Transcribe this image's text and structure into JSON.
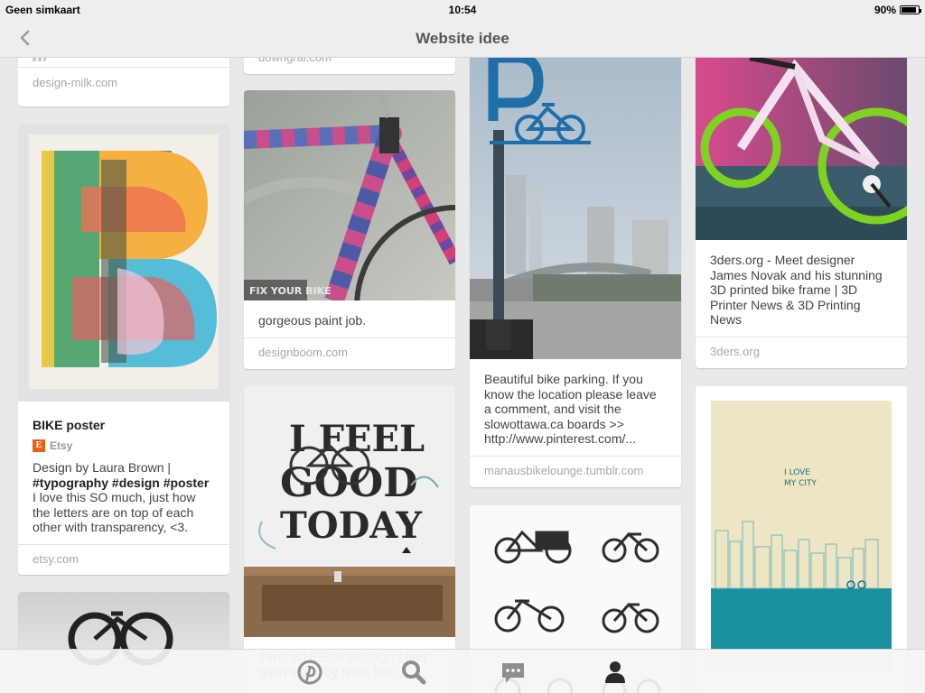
{
  "status_bar": {
    "carrier": "Geen simkaart",
    "time": "10:54",
    "battery": "90%",
    "battery_level": 0.9
  },
  "nav": {
    "title": "Website idee",
    "back_icon": "chevron-left-icon"
  },
  "pins": {
    "c1_top": {
      "source": "design-milk.com"
    },
    "bike_poster": {
      "title": "BIKE poster",
      "shop": "Etsy",
      "desc_prefix": "Design by Laura Brown | ",
      "tag1": "#typography",
      "tag2": "#design",
      "tag3": "#poster",
      "desc_suffix": " I love this SO much, just how the letters are on top of each other with transparency, <3.",
      "source": "etsy.com"
    },
    "c2_top": {
      "source": "downgrai.com"
    },
    "paint_job": {
      "text": "gorgeous paint job.",
      "source": "designboom.com",
      "image_text": "FIX YOUR BIKE"
    },
    "feel_good": {
      "image_text_1": "I FEEL",
      "image_text_2": "GOOD",
      "image_text_3": "TODAY",
      "caption": "TWO WHEELS GOOD - I feel good today by Neils Buc..."
    },
    "bike_parking": {
      "text": "Beautiful bike parking. If you know the location please leave a comment, and visit the slowottawa.ca boards >> http://www.pinterest.com/...",
      "source": "manausbikelounge.tumblr.com"
    },
    "novak": {
      "text": "3ders.org - Meet designer James Novak and his stunning 3D printed bike frame | 3D Printer News & 3D Printing News",
      "source": "3ders.org"
    },
    "city_poster": {
      "image_text": "I LOVE MY CITY"
    }
  },
  "tabbar": {
    "tabs": [
      {
        "name": "home",
        "icon": "pinterest-icon"
      },
      {
        "name": "search",
        "icon": "search-icon"
      },
      {
        "name": "messages",
        "icon": "chat-bubble-icon"
      },
      {
        "name": "profile",
        "icon": "person-icon"
      }
    ]
  },
  "colors": {
    "accent_etsy": "#e8611a",
    "bike_green": "#7ed321",
    "sign_blue": "#1f6ea8",
    "teal": "#1a8fa0"
  }
}
